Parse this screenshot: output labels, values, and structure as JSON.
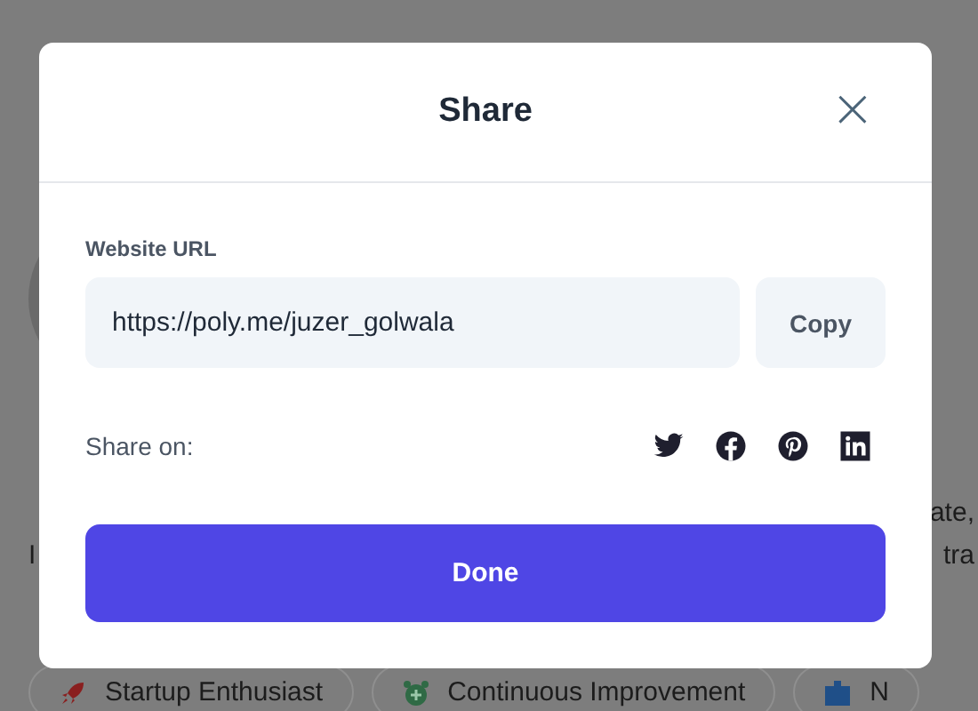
{
  "background_page": {
    "bio_line_start": "I",
    "bio_fragment_1": "ate,",
    "bio_fragment_2": "tra",
    "tags": [
      {
        "label": "Startup Enthusiast",
        "kind": "rocket"
      },
      {
        "label": "Continuous Improvement",
        "kind": "alarm"
      },
      {
        "label": "N",
        "kind": "box"
      }
    ]
  },
  "dialog": {
    "title": "Share",
    "close": "×",
    "url_label": "Website URL",
    "url_value": "https://poly.me/juzer_golwala",
    "copy_button": "Copy",
    "share_label": "Share on:",
    "share_targets": [
      {
        "kind": "twitter"
      },
      {
        "kind": "facebook"
      },
      {
        "kind": "pinterest"
      },
      {
        "kind": "linkedin"
      }
    ],
    "done_button": "Done"
  }
}
